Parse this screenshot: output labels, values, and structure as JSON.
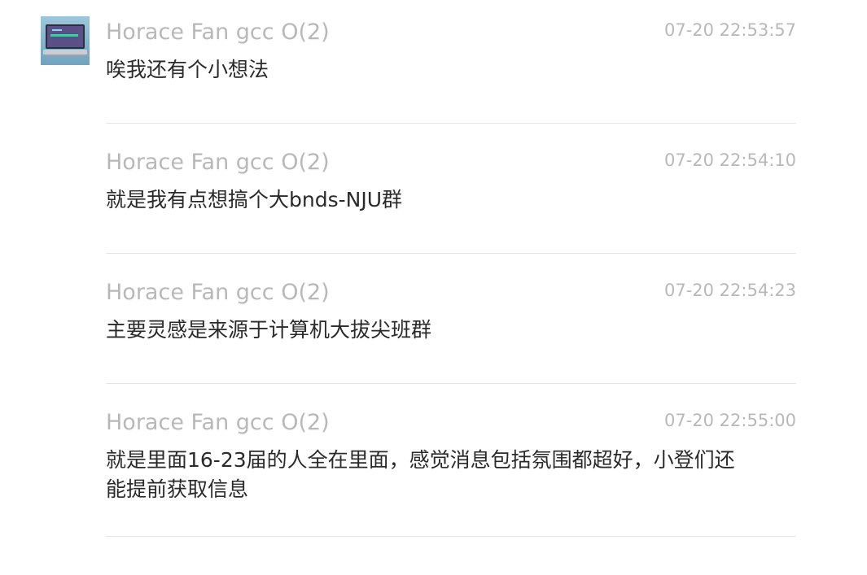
{
  "messages": [
    {
      "sender": "Horace Fan gcc O(2)",
      "time": "07-20 22:53:57",
      "text": "唉我还有个小想法"
    },
    {
      "sender": "Horace Fan gcc O(2)",
      "time": "07-20 22:54:10",
      "text": "就是我有点想搞个大bnds-NJU群"
    },
    {
      "sender": "Horace Fan gcc O(2)",
      "time": "07-20 22:54:23",
      "text": "主要灵感是来源于计算机大拔尖班群"
    },
    {
      "sender": "Horace Fan gcc O(2)",
      "time": "07-20 22:55:00",
      "text": "就是里面16-23届的人全在里面，感觉消息包括氛围都超好，小登们还能提前获取信息"
    }
  ]
}
